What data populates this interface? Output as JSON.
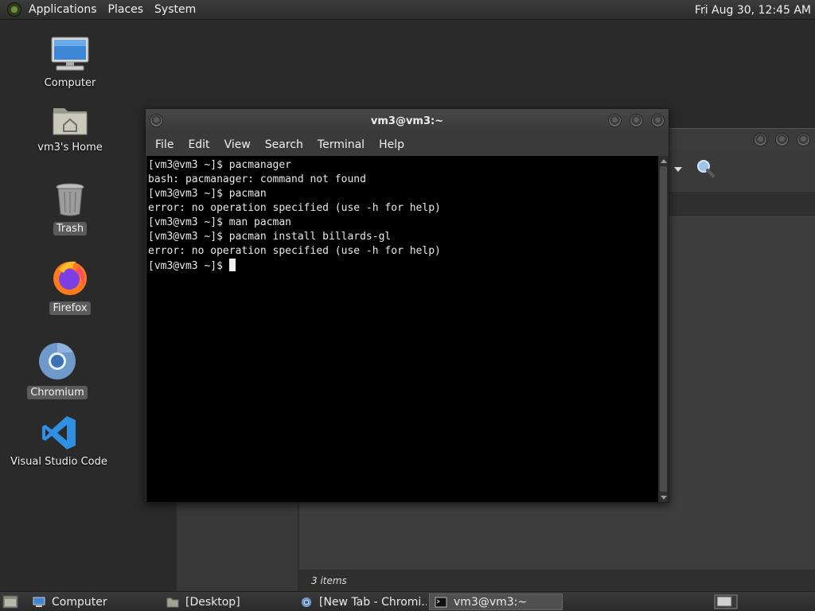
{
  "top_panel": {
    "menus": [
      "Applications",
      "Places",
      "System"
    ],
    "clock": "Fri Aug 30, 12:45 AM"
  },
  "desktop_icons": [
    {
      "label": "Computer",
      "icon": "computer-icon"
    },
    {
      "label": "vm3's Home",
      "icon": "home-folder-icon"
    },
    {
      "label": "Trash",
      "icon": "trash-icon"
    },
    {
      "label": "Firefox",
      "icon": "firefox-icon"
    },
    {
      "label": "Chromium",
      "icon": "chromium-icon"
    },
    {
      "label": "Visual Studio Code",
      "icon": "vscode-icon"
    }
  ],
  "terminal": {
    "title": "vm3@vm3:~",
    "menus": [
      "File",
      "Edit",
      "View",
      "Search",
      "Terminal",
      "Help"
    ],
    "lines": [
      "[vm3@vm3 ~]$ pacmanager",
      "bash: pacmanager: command not found",
      "[vm3@vm3 ~]$ pacman",
      "error: no operation specified (use -h for help)",
      "[vm3@vm3 ~]$ man pacman",
      "[vm3@vm3 ~]$ pacman install billards-gl",
      "error: no operation specified (use -h for help)"
    ],
    "prompt": "[vm3@vm3 ~]$ "
  },
  "file_manager": {
    "status": "3 items"
  },
  "taskbar": [
    {
      "label": "Computer",
      "icon": "computer-icon",
      "active": false
    },
    {
      "label": "[Desktop]",
      "icon": "folder-icon",
      "active": false
    },
    {
      "label": "[New Tab - Chromi...",
      "icon": "chromium-icon",
      "active": false
    },
    {
      "label": "vm3@vm3:~",
      "icon": "terminal-icon",
      "active": true
    }
  ],
  "colors": {
    "desktop": "#2a2a2a",
    "terminal_bg": "#000000",
    "vscode_blue": "#2f8fe0"
  }
}
